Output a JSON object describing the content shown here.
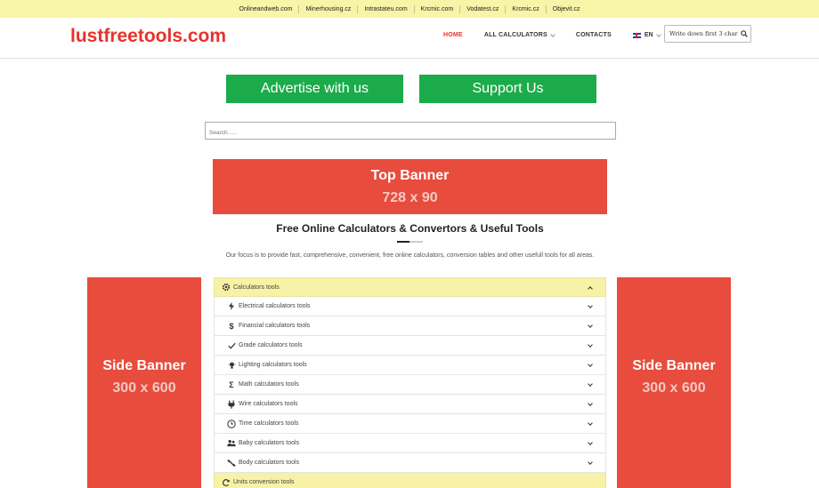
{
  "topbar": {
    "links": [
      "Onlineandweb.com",
      "Minerhousing.cz",
      "Intrastateu.com",
      "Krcmic.com",
      "Vodatest.cz",
      "Krcmic.cz",
      "Objevit.cz"
    ]
  },
  "header": {
    "logo": "lustfreetools.com",
    "nav": {
      "home": "HOME",
      "all_calculators": "ALL CALCULATORS",
      "contacts": "CONTACTS",
      "language": "EN"
    },
    "search_value": "Write down first 3 characte",
    "search_icon": "search-icon"
  },
  "buttons": {
    "advertise": "Advertise with us",
    "support": "Support Us"
  },
  "main_search": {
    "placeholder": "Search......"
  },
  "top_banner": {
    "title": "Top Banner",
    "size": "728 x 90"
  },
  "heading": "Free Online Calculators & Convertors & Useful Tools",
  "focus_text": "Our focus is to provide fast, comprehensive, convenient, free online calculators, conversion tables and other usefull tools for all areas.",
  "side_banner": {
    "title": "Side Banner",
    "size": "300 x 600"
  },
  "accordion": {
    "section_title": "Calculators tools",
    "items": [
      {
        "label": "Electrical calculators tools",
        "icon": "lightning-icon"
      },
      {
        "label": "Financial calculators tools",
        "icon": "dollar-icon"
      },
      {
        "label": "Grade calculators tools",
        "icon": "check-icon"
      },
      {
        "label": "Lighting calculators tools",
        "icon": "bulb-icon"
      },
      {
        "label": "Math calculators tools",
        "icon": "sigma-icon"
      },
      {
        "label": "Wire calculators tools",
        "icon": "plug-icon"
      },
      {
        "label": "Time calculators tools",
        "icon": "clock-icon"
      },
      {
        "label": "Baby calculators tools",
        "icon": "people-icon"
      },
      {
        "label": "Body calculators tools",
        "icon": "dumbbell-icon"
      }
    ],
    "next_section_title": "Units conversion tools"
  },
  "colors": {
    "brand_red": "#e8322d",
    "banner_red": "#e74c3c",
    "green": "#1cab4a",
    "yellow": "#f7f2a6"
  }
}
